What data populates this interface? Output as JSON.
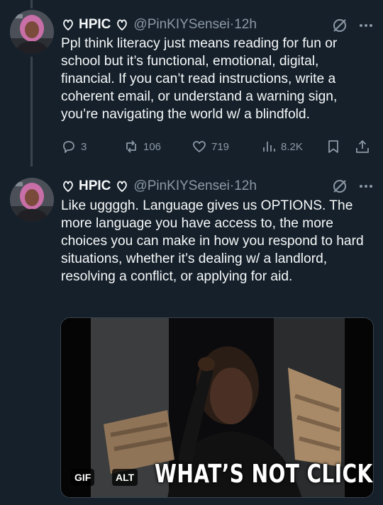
{
  "colors": {
    "background": "#15202b",
    "text": "#f7f9f9",
    "muted": "#8b98a5",
    "line": "#38444d"
  },
  "tweets": [
    {
      "name": "HPIC",
      "handle": "@PinKIYSensei",
      "time": "12h",
      "text": "Ppl think literacy just means reading for fun or school but it’s functional, emotional, digital, financial. If you can’t read instructions, write a coherent email, or understand a warning sign, you’re navigating the world w/ a blindfold.",
      "replies": "3",
      "retweets": "106",
      "likes": "719",
      "views": "8.2K"
    },
    {
      "name": "HPIC",
      "handle": "@PinKIYSensei",
      "time": "12h",
      "text": "Like uggggh. Language gives us OPTIONS. The more language you have access to, the more choices you can make in how you respond to hard situations, whether it’s dealing w/ a landlord, resolving a conflict, or applying for aid.",
      "media": {
        "caption": "WHAT’S NOT CLICKING?",
        "gif_label": "GIF",
        "alt_label": "ALT"
      }
    }
  ]
}
